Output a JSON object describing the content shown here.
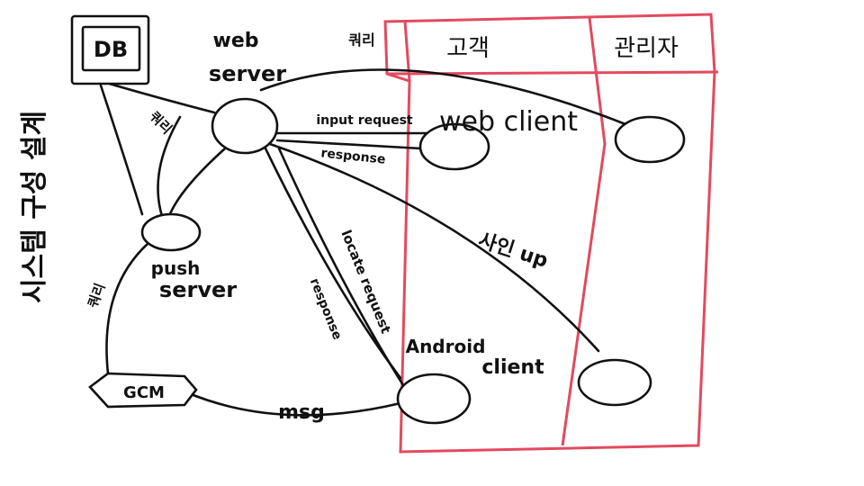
{
  "diagram": {
    "side_title": "시스템 구성 설계",
    "db_label": "DB",
    "web_server_label_1": "web",
    "web_server_label_2": "server",
    "push_server_label_1": "push",
    "push_server_label_2": "server",
    "gcm_label": "GCM",
    "edges": {
      "db_web": "쿼리",
      "db_push": "쿼리",
      "web_to_admin": "쿼리",
      "push_gcm": "쿼리",
      "input_request": "input request",
      "response": "response",
      "locate_request": "locate request",
      "locate_response": "response",
      "sign_up": "사인 up",
      "msg": "msg"
    },
    "table": {
      "col_customer": "고객",
      "col_admin": "관리자"
    },
    "web_client_label": "web client",
    "android_client_label_1": "Android",
    "android_client_label_2": "client"
  }
}
